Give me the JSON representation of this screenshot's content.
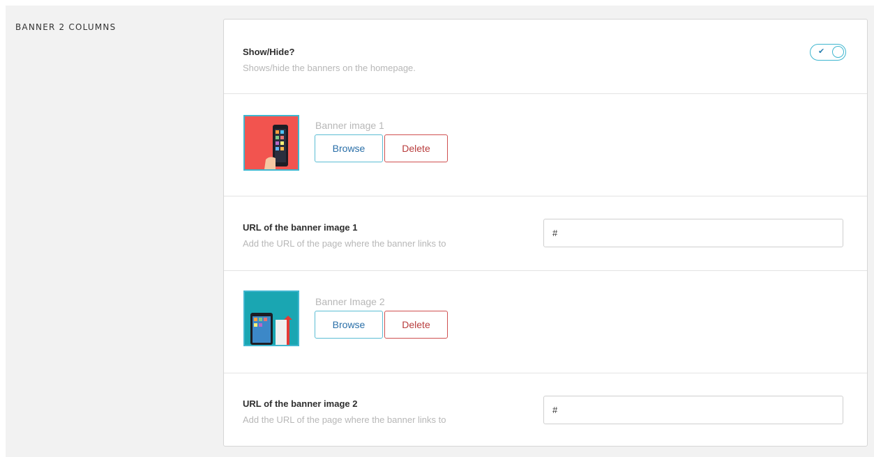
{
  "section": {
    "title": "BANNER 2 COLUMNS"
  },
  "show_hide": {
    "label": "Show/Hide?",
    "description": "Shows/hide the banners on the homepage.",
    "toggle_on": true,
    "toggle_check": "✔"
  },
  "banner1": {
    "image_label": "Banner image 1",
    "browse_label": "Browse",
    "delete_label": "Delete",
    "thumb_color": "#f2544f",
    "url_label": "URL of the banner image 1",
    "url_description": "Add the URL of the page where the banner links to",
    "url_value": "#"
  },
  "banner2": {
    "image_label": "Banner Image 2",
    "browse_label": "Browse",
    "delete_label": "Delete",
    "thumb_color": "#1aa6b2",
    "url_label": "URL of the banner image 2",
    "url_description": "Add the URL of the page where the banner links to",
    "url_value": "#"
  },
  "colors": {
    "accent": "#3fb6cf",
    "delete": "#d05050",
    "muted_text": "#b7b7b7"
  }
}
